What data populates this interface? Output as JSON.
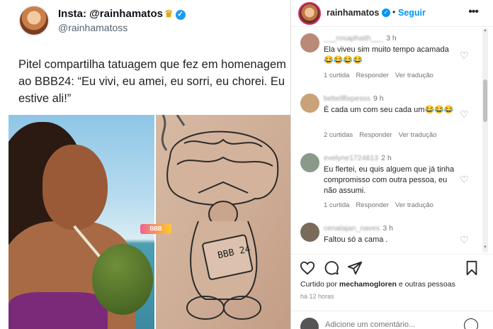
{
  "left_post": {
    "name": "Insta: @rainhamatos",
    "crown_icon": "crown-icon",
    "verified_icon": "verified-badge-icon",
    "handle": "@rainhamatoss",
    "caption": "Pitel compartilha tatuagem que fez em homenagem ao BBB24: “Eu vivi, eu amei, eu sorri, eu chorei. Eu estive ali!”",
    "tattoo_text": "BBB 24"
  },
  "instagram": {
    "username": "rainhamatos",
    "separator": "•",
    "follow_label": "Seguir",
    "more_icon": "more-horizontal-icon",
    "comments": [
      {
        "user": "___rosaphaith___",
        "time": "3 h",
        "text": "Ela viveu sim muito tempo acamada😂😂😂😂",
        "likes": "1 curtida",
        "reply": "Responder",
        "translate": "Ver tradução",
        "avatar_color": "#b98a77"
      },
      {
        "user": "bebellfixpesss",
        "time": "9 h",
        "text": "É cada um com seu cada um😂😂😂",
        "likes": "2 curtidas",
        "reply": "Responder",
        "translate": "Ver tradução",
        "avatar_color": "#c9a27a"
      },
      {
        "user": "evelyne1724813",
        "time": "2 h",
        "text": "Eu flertei, eu quis alguem que já tinha compromisso com outra pessoa, eu não assumi.",
        "likes": "1 curtida",
        "reply": "Responder",
        "translate": "Ver tradução",
        "avatar_color": "#8a9a8a"
      },
      {
        "user": "cenatajan_naves",
        "time": "3 h",
        "text": "Faltou só a cama .",
        "likes": "",
        "reply": "",
        "translate": "",
        "avatar_color": "#7a6a5a"
      }
    ],
    "liked_by_prefix": "Curtido por ",
    "liked_by_user": "mechamogloren",
    "liked_by_suffix": " e outras pessoas",
    "post_time": "há 12 horas",
    "add_comment_placeholder": "Adicione um comentário...",
    "icons": {
      "like": "heart-icon",
      "comment": "comment-icon",
      "share": "share-icon",
      "save": "bookmark-icon",
      "emoji": "emoji-icon"
    }
  },
  "colors": {
    "link_blue": "#0095f6",
    "twitter_blue": "#1d9bf0",
    "muted": "#737373"
  }
}
